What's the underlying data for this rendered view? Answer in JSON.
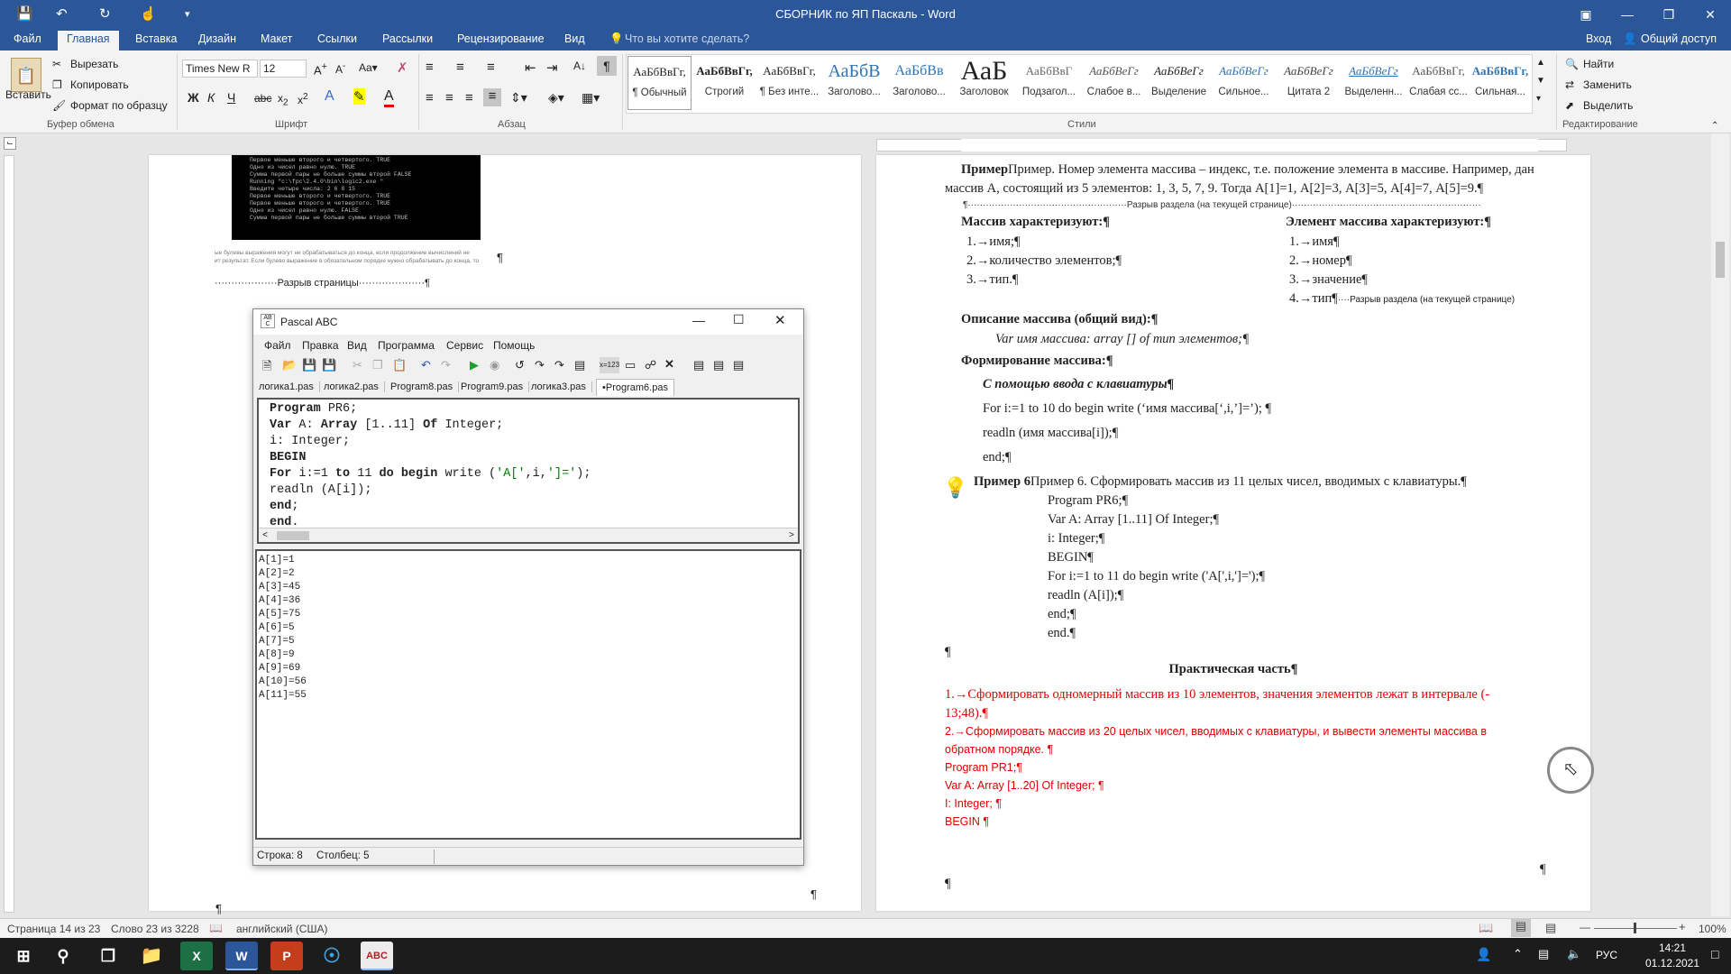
{
  "window": {
    "title": "СБОРНИК по ЯП Паскаль - Word"
  },
  "ribbon_tabs": [
    "Файл",
    "Главная",
    "Вставка",
    "Дизайн",
    "Макет",
    "Ссылки",
    "Рассылки",
    "Рецензирование",
    "Вид"
  ],
  "tell_me": "Что вы хотите сделать?",
  "signin": "Вход",
  "share": "Общий доступ",
  "clipboard": {
    "paste": "Вставить",
    "cut": "Вырезать",
    "copy": "Копировать",
    "format": "Формат по образцу",
    "label": "Буфер обмена"
  },
  "font": {
    "name": "Times New R",
    "size": "12",
    "label": "Шрифт"
  },
  "paragraph_label": "Абзац",
  "styles": {
    "label": "Стили",
    "items": [
      {
        "preview": "АаБбВвГг,",
        "name": "¶ Обычный"
      },
      {
        "preview": "АаБбВвГг,",
        "name": "Строгий"
      },
      {
        "preview": "АаБбВвГг,",
        "name": "¶ Без инте..."
      },
      {
        "preview": "АаБбВ",
        "name": "Заголово..."
      },
      {
        "preview": "АаБбВв",
        "name": "Заголово..."
      },
      {
        "preview": "АаБ",
        "name": "Заголовок"
      },
      {
        "preview": "АаБбВвГ",
        "name": "Подзагол..."
      },
      {
        "preview": "АаБбВеГг",
        "name": "Слабое в..."
      },
      {
        "preview": "АаБбВеГг",
        "name": "Выделение"
      },
      {
        "preview": "АаБбВеГг",
        "name": "Сильное..."
      },
      {
        "preview": "АаБбВеГг",
        "name": "Цитата 2"
      },
      {
        "preview": "АаБбВеГг",
        "name": "Выделенн..."
      },
      {
        "preview": "АаБбВвГг,",
        "name": "Слабая сс..."
      },
      {
        "preview": "АаБбВвГг,",
        "name": "Сильная..."
      }
    ]
  },
  "editing": {
    "find": "Найти",
    "replace": "Заменить",
    "select": "Выделить",
    "label": "Редактирование"
  },
  "left_page": {
    "console_lines": [
      "Первое меньше второго и четвертого. TRUE",
      "Одно из чисел равно нулю. TRUE",
      "Сумма первой пары не больше суммы второй FALSE",
      "",
      "Running \"c:\\fpc\\2.4.0\\bin\\logic2.exe \"",
      "Введите четыре числа: 2 6 8 15",
      "Первое меньше второго и четвертого. TRUE",
      "Первое меньше второго и четвертого. TRUE",
      "Одно из чисел равно нулю. FALSE",
      "Сумма первой пары не больше суммы второй TRUE"
    ],
    "small_text_1": "ые булевы выражения могут не обрабатываться до конца, если продолжение вычислений не",
    "small_text_2": "ит результат. Если булево выражение в обязательном порядке нужно обрабатывать до конца, то",
    "page_break": "Разрыв страницы",
    "pilcrow": "¶"
  },
  "pascal": {
    "title": "Pascal ABC",
    "menu": [
      "Файл",
      "Правка",
      "Вид",
      "Программа",
      "Сервис",
      "Помощь"
    ],
    "tabs": [
      "логика1.pas",
      "логика2.pas",
      "Program8.pas",
      "Program9.pas",
      "логика3.pas",
      "•Program6.pas"
    ],
    "code": [
      "Program PR6;",
      "Var A: Array [1..11] Of Integer;",
      "i: Integer;",
      "BEGIN",
      "For i:=1 to 11 do begin write ('A[',i,']=');",
      "readln (A[i]);",
      "end;",
      "end."
    ],
    "output": [
      "A[1]=1",
      "A[2]=2",
      "A[3]=45",
      "A[4]=36",
      "A[5]=75",
      "A[6]=5",
      "A[7]=5",
      "A[8]=9",
      "A[9]=69",
      "A[10]=56",
      "A[11]=55"
    ],
    "status_row": "Строка: 8",
    "status_col": "Столбец: 5"
  },
  "right_page": {
    "p1a": "Пример. Номер элемента массива – индекс, т.е. положение элемента в массиве. Например, дан",
    "p1b": "массив А, состоящий из 5 элементов: 1, 3, 5, 7, 9. Тогда А[1]=1, А[2]=3, А[3]=5, А[4]=7, А[5]=9.¶",
    "section_break": "Разрыв раздела (на текущей странице)",
    "col1_head": "Массив характеризуют:¶",
    "col1_items": [
      "1.→имя;¶",
      "2.→количество элементов;¶",
      "3.→тип.¶"
    ],
    "col2_head": "Элемент массива характеризуют:¶",
    "col2_items": [
      "1.→имя¶",
      "2.→номер¶",
      "3.→значение¶",
      "4.→тип¶"
    ],
    "desc_head": "Описание массива (общий вид):¶",
    "desc_line": "Var имя массива: array [] of тип элементов;¶",
    "form_head": "Формирование массива:¶",
    "form_sub": "С помощью ввода с клавиатуры¶",
    "form_l1": "For i:=1 to 10 do begin write (‘имя массива[‘,i,’]=’); ¶",
    "form_l2": "readln (имя массива[i]);¶",
    "form_l3": "end;¶",
    "ex6_head": "Пример 6. Сформировать массив из 11 целых чисел, вводимых с клавиатуры.¶",
    "ex6_code": [
      "Program PR6;¶",
      "Var A: Array [1..11] Of Integer;¶",
      "i: Integer;¶",
      "BEGIN¶",
      "For i:=1 to 11 do begin write ('A[',i,']=');¶",
      "readln (A[i]);¶",
      "end;¶",
      "end.¶"
    ],
    "pilcrow": "¶",
    "practice_head": "Практическая часть¶",
    "task1a": "1.→Сформировать одномерный массив из 10 элементов, значения элементов лежат в интервале (-",
    "task1b": "13;48).¶",
    "task2a": "2.→Сформировать массив из 20 целых чисел, вводимых с клавиатуры, и вывести элементы массива в",
    "task2b": "обратном порядке. ¶",
    "red_code": [
      "Program PR1;¶",
      "Var A: Array [1..20] Of Integer; ¶",
      "I: Integer; ¶",
      "BEGIN ¶"
    ]
  },
  "status": {
    "page": "Страница 14 из 23",
    "words": "Слово 23 из 3228",
    "lang": "английский (США)",
    "zoom": "100%"
  },
  "taskbar": {
    "time": "14:21",
    "date": "01.12.2021",
    "lang": "РУС"
  }
}
